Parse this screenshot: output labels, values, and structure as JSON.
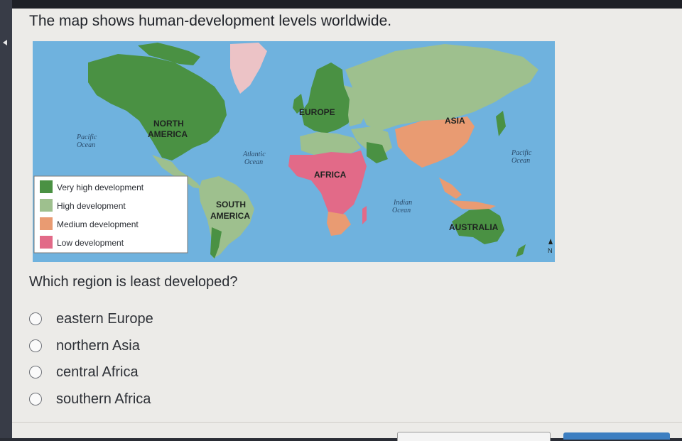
{
  "prompt": "The map shows human-development levels worldwide.",
  "map": {
    "labels": {
      "north_america": [
        "NORTH",
        "AMERICA"
      ],
      "south_america": [
        "SOUTH",
        "AMERICA"
      ],
      "europe": "EUROPE",
      "asia": "ASIA",
      "africa": "AFRICA",
      "australia": "AUSTRALIA",
      "pacific_left": [
        "Pacific",
        "Ocean"
      ],
      "pacific_right": [
        "Pacific",
        "Ocean"
      ],
      "atlantic": [
        "Atlantic",
        "Ocean"
      ],
      "indian": [
        "Indian",
        "Ocean"
      ],
      "north_arrow": "N"
    },
    "legend": [
      {
        "label": "Very high development",
        "color": "#4a9143"
      },
      {
        "label": "High development",
        "color": "#9ec08e"
      },
      {
        "label": "Medium development",
        "color": "#e99b72"
      },
      {
        "label": "Low development",
        "color": "#e26a88"
      }
    ],
    "colors": {
      "ocean": "#6fb2de",
      "greenland": "#ecc3c6"
    }
  },
  "question": "Which region is least developed?",
  "options": [
    {
      "label": "eastern Europe"
    },
    {
      "label": "northern Asia"
    },
    {
      "label": "central Africa"
    },
    {
      "label": "southern Africa"
    }
  ]
}
